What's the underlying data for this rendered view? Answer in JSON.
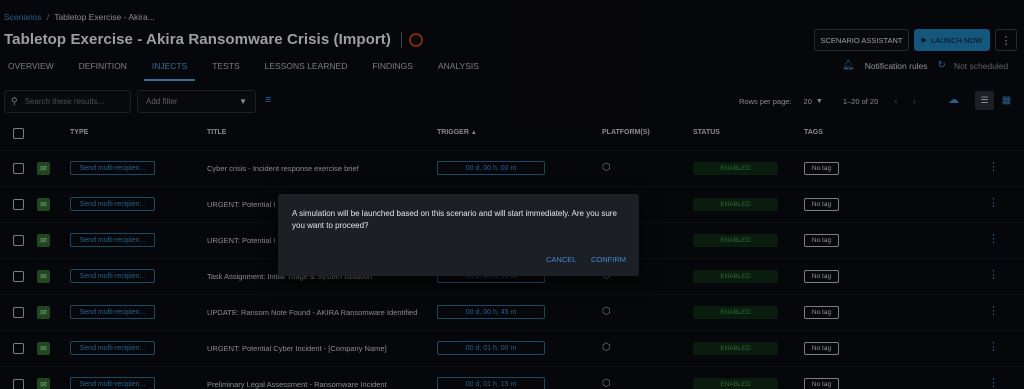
{
  "breadcrumb": {
    "root": "Scenarios",
    "separator": "/",
    "current": "Tabletop Exercise - Akira..."
  },
  "header": {
    "title": "Tabletop Exercise - Akira Ransomware Crisis (Import)",
    "assistant_label": "SCENARIO ASSISTANT",
    "launch_label": "LAUNCH NOW",
    "more_icon": "more-vert-icon"
  },
  "tabs": [
    {
      "label": "OVERVIEW"
    },
    {
      "label": "DEFINITION"
    },
    {
      "label": "INJECTS",
      "active": true
    },
    {
      "label": "TESTS"
    },
    {
      "label": "LESSONS LEARNED"
    },
    {
      "label": "FINDINGS"
    },
    {
      "label": "ANALYSIS"
    }
  ],
  "notifications": {
    "label": "Notification rules",
    "schedule": "Not scheduled"
  },
  "toolbar": {
    "search_placeholder": "Search these results...",
    "filter_label": "Add filter",
    "rows_per_page_label": "Rows per page:",
    "rows_per_page": "20",
    "range": "1–20 of 20"
  },
  "table": {
    "columns": {
      "type": "TYPE",
      "title": "TITLE",
      "trigger": "TRIGGER",
      "platforms": "PLATFORM(S)",
      "status": "STATUS",
      "tags": "TAGS"
    },
    "rows": [
      {
        "type": "Send multi-recipien...",
        "title": "Cyber crisis - Incident response exercise brief",
        "trigger": "00 d, 00 h, 00 m",
        "status": "ENABLED",
        "tag": "No tag"
      },
      {
        "type": "Send multi-recipien...",
        "title": "URGENT: Potential I",
        "trigger": "",
        "status": "ENABLED",
        "tag": "No tag"
      },
      {
        "type": "Send multi-recipien...",
        "title": "URGENT: Potential I",
        "trigger": "",
        "status": "ENABLED",
        "tag": "No tag"
      },
      {
        "type": "Send multi-recipien...",
        "title": "Task Assignment: Initial Triage & System Isolation",
        "trigger": "00 d, 00 h, 30 m",
        "status": "ENABLED",
        "tag": "No tag"
      },
      {
        "type": "Send multi-recipien...",
        "title": "UPDATE: Ransom Note Found - AKIRA Ransomware Identified",
        "trigger": "00 d, 00 h, 45 m",
        "status": "ENABLED",
        "tag": "No tag"
      },
      {
        "type": "Send multi-recipien...",
        "title": "URGENT: Potential Cyber Incident - [Company Name]",
        "trigger": "00 d, 01 h, 00 m",
        "status": "ENABLED",
        "tag": "No tag"
      },
      {
        "type": "Send multi-recipien...",
        "title": "Preliminary Legal Assessment - Ransomware Incident",
        "trigger": "00 d, 01 h, 15 m",
        "status": "ENABLED",
        "tag": "No tag"
      }
    ]
  },
  "dialog": {
    "message": "A simulation will be launched based on this scenario and will start immediately. Are you sure you want to proceed?",
    "cancel_label": "CANCEL",
    "confirm_label": "CONFIRM"
  },
  "colors": {
    "accent": "#3d8bd0",
    "launch_button": "#1f7fb8",
    "status_enabled": "#3fa14a",
    "status_ring": "#c0392b"
  }
}
